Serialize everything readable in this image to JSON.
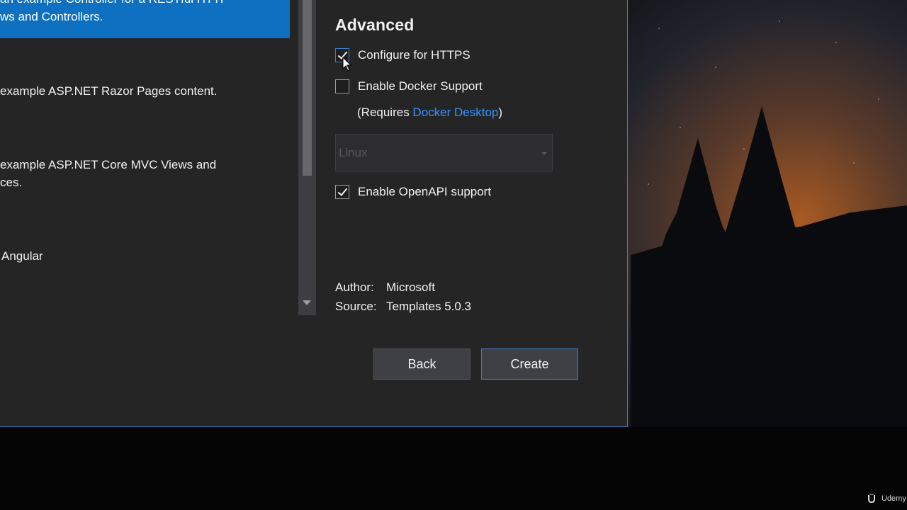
{
  "template_list": {
    "items": [
      {
        "lines": [
          "an example Controller for a RESTful HTTP",
          "ws and Controllers."
        ],
        "selected": true
      },
      {
        "lines": [
          "example ASP.NET Razor Pages content."
        ],
        "selected": false
      },
      {
        "lines": [
          "example ASP.NET Core MVC Views and",
          "ces."
        ],
        "selected": false
      },
      {
        "lines": [
          "Angular"
        ],
        "selected": false
      }
    ]
  },
  "advanced": {
    "title": "Advanced",
    "configure_https": {
      "label": "Configure for HTTPS",
      "checked": true
    },
    "docker_support": {
      "label": "Enable Docker Support",
      "checked": false
    },
    "docker_note_prefix": "(Requires ",
    "docker_note_link": "Docker Desktop",
    "docker_note_suffix": ")",
    "os_select": {
      "value": "Linux",
      "disabled": true
    },
    "openapi_support": {
      "label": "Enable OpenAPI support",
      "checked": true
    }
  },
  "meta": {
    "author_label": "Author:",
    "author_value": "Microsoft",
    "source_label": "Source:",
    "source_value": "Templates 5.0.3"
  },
  "buttons": {
    "back_label": "Back",
    "create_label": "Create"
  },
  "watermark": {
    "text": "Udemy"
  },
  "colors": {
    "accent": "#0e70c0",
    "link": "#3794ff",
    "dialog_bg": "#252526",
    "focus_border": "#3a7fc7"
  }
}
